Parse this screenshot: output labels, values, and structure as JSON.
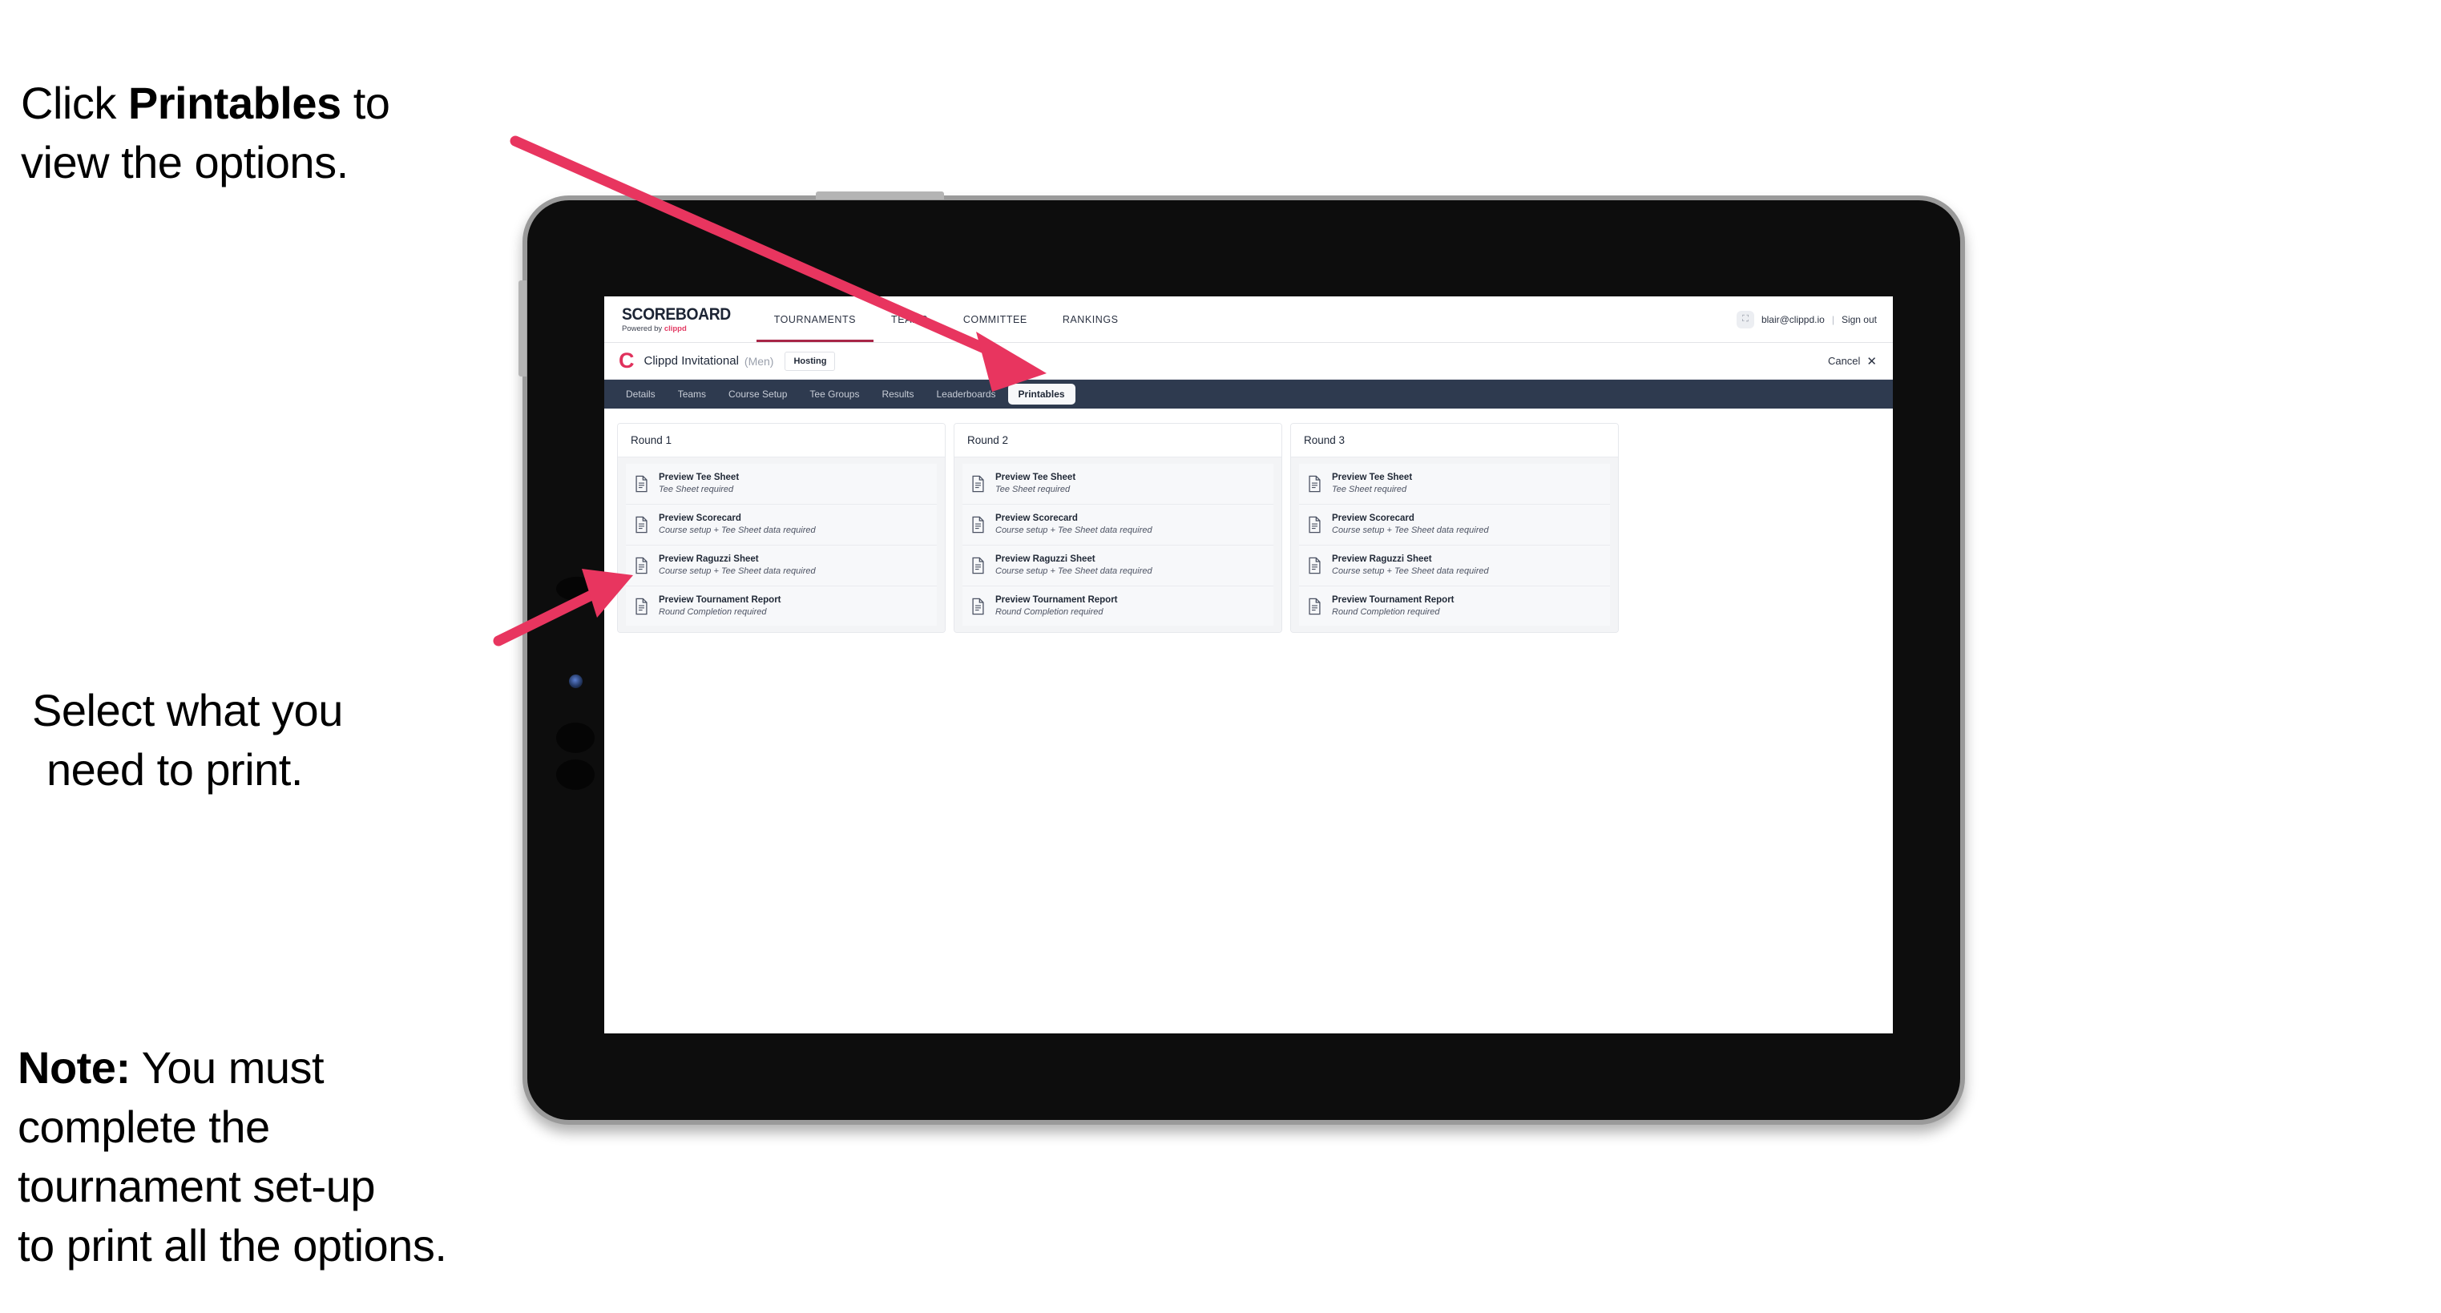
{
  "annotations": {
    "click_printables": {
      "pre": "Click ",
      "bold": "Printables",
      "post": " to\nview the options."
    },
    "select_line1": "Select what you",
    "select_line2": "need to print.",
    "note": {
      "bold": "Note:",
      "body": " You must\ncomplete the\ntournament set-up\nto print all the options."
    }
  },
  "app": {
    "brand": {
      "title": "SCOREBOARD",
      "sub_prefix": "Powered by ",
      "sub_brand": "clippd"
    },
    "top_nav": [
      {
        "label": "TOURNAMENTS",
        "active": true
      },
      {
        "label": "TEAMS",
        "active": false
      },
      {
        "label": "COMMITTEE",
        "active": false
      },
      {
        "label": "RANKINGS",
        "active": false
      }
    ],
    "account": {
      "avatar_glyph": "⛶",
      "email": "blair@clippd.io",
      "separator": "|",
      "sign_out": "Sign out"
    },
    "title_row": {
      "logo_letter": "C",
      "tournament_name": "Clippd Invitational",
      "gender": "(Men)",
      "badge": "Hosting",
      "cancel_label": "Cancel",
      "cancel_icon": "✕"
    },
    "sub_tabs": [
      {
        "label": "Details",
        "active": false
      },
      {
        "label": "Teams",
        "active": false
      },
      {
        "label": "Course Setup",
        "active": false
      },
      {
        "label": "Tee Groups",
        "active": false
      },
      {
        "label": "Results",
        "active": false
      },
      {
        "label": "Leaderboards",
        "active": false
      },
      {
        "label": "Printables",
        "active": true
      }
    ],
    "rounds": [
      {
        "heading": "Round 1",
        "items": [
          {
            "title": "Preview Tee Sheet",
            "subtitle": "Tee Sheet required",
            "icon": "document-icon"
          },
          {
            "title": "Preview Scorecard",
            "subtitle": "Course setup + Tee Sheet data required",
            "icon": "document-icon"
          },
          {
            "title": "Preview Raguzzi Sheet",
            "subtitle": "Course setup + Tee Sheet data required",
            "icon": "document-icon"
          },
          {
            "title": "Preview Tournament Report",
            "subtitle": "Round Completion required",
            "icon": "document-icon"
          }
        ]
      },
      {
        "heading": "Round 2",
        "items": [
          {
            "title": "Preview Tee Sheet",
            "subtitle": "Tee Sheet required",
            "icon": "document-icon"
          },
          {
            "title": "Preview Scorecard",
            "subtitle": "Course setup + Tee Sheet data required",
            "icon": "document-icon"
          },
          {
            "title": "Preview Raguzzi Sheet",
            "subtitle": "Course setup + Tee Sheet data required",
            "icon": "document-icon"
          },
          {
            "title": "Preview Tournament Report",
            "subtitle": "Round Completion required",
            "icon": "document-icon"
          }
        ]
      },
      {
        "heading": "Round 3",
        "items": [
          {
            "title": "Preview Tee Sheet",
            "subtitle": "Tee Sheet required",
            "icon": "document-icon"
          },
          {
            "title": "Preview Scorecard",
            "subtitle": "Course setup + Tee Sheet data required",
            "icon": "document-icon"
          },
          {
            "title": "Preview Raguzzi Sheet",
            "subtitle": "Course setup + Tee Sheet data required",
            "icon": "document-icon"
          },
          {
            "title": "Preview Tournament Report",
            "subtitle": "Round Completion required",
            "icon": "document-icon"
          }
        ]
      }
    ]
  },
  "colors": {
    "accent_pink": "#E8355F",
    "brand_crimson": "#E0315C",
    "nav_dark": "#2E3A4F",
    "active_underline": "#A82647",
    "device_body": "#0D0D0D",
    "device_edge": "#9A9A9A"
  }
}
